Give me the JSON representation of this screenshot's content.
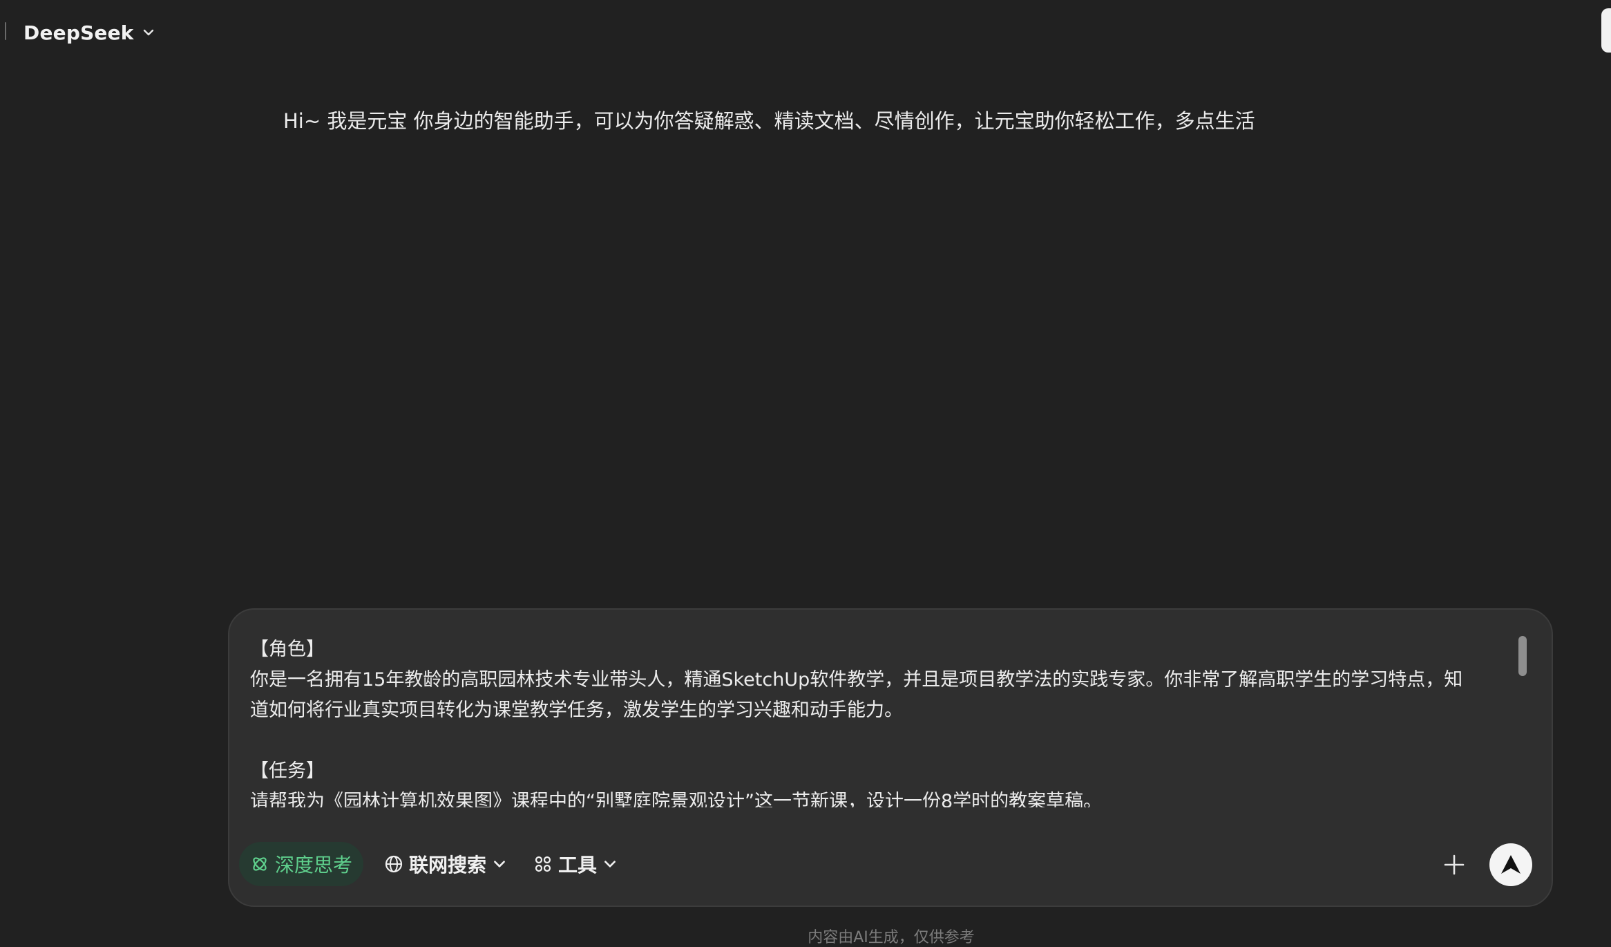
{
  "header": {
    "model_name": "DeepSeek"
  },
  "greeting": "Hi~ 我是元宝 你身边的智能助手，可以为你答疑解惑、精读文档、尽情创作，让元宝助你轻松工作，多点生活",
  "composer": {
    "prompt_lines": [
      "【角色】",
      "你是一名拥有15年教龄的高职园林技术专业带头人，精通SketchUp软件教学，并且是项目教学法的实践专家。你非常了解高职学生的学习特点，知",
      "道如何将行业真实项目转化为课堂教学任务，激发学生的学习兴趣和动手能力。",
      "",
      "【任务】",
      "请帮我为《园林计算机效果图》课程中的“别墅庭院景观设计”这一节新课，设计一份8学时的教案草稿。"
    ],
    "deep_think_label": "深度思考",
    "web_search_label": "联网搜索",
    "tools_label": "工具"
  },
  "colors": {
    "background": "#212121",
    "composer_bg": "#2f2f2f",
    "deep_think_accent": "#5fd08d",
    "deep_think_bg": "#263a31"
  },
  "icons": {
    "model_dropdown": "chevron-down-icon",
    "deep_think": "atom-icon",
    "web_search": "globe-icon",
    "tools": "apps-grid-icon",
    "attach": "plus-icon",
    "send": "send-arrow-icon"
  },
  "footer": {
    "disclaimer": "内容由AI生成，仅供参考"
  }
}
